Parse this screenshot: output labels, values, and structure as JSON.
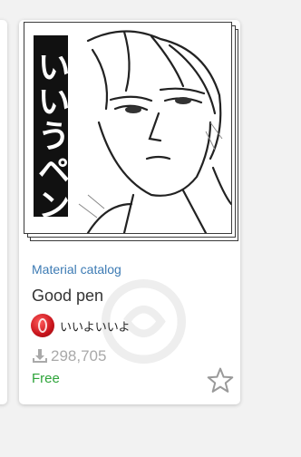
{
  "card": {
    "category": "Material catalog",
    "title": "Good pen",
    "author_name": "いいよいいよ",
    "download_count": "298,705",
    "price": "Free",
    "thumbnail_label": "いいうペン"
  },
  "icons": {
    "download": "download-icon",
    "favorite": "star-outline-icon",
    "avatar": "avatar"
  },
  "colors": {
    "category": "#3d7bb4",
    "price": "#2ea43a",
    "downloads": "#a9a9a9"
  }
}
